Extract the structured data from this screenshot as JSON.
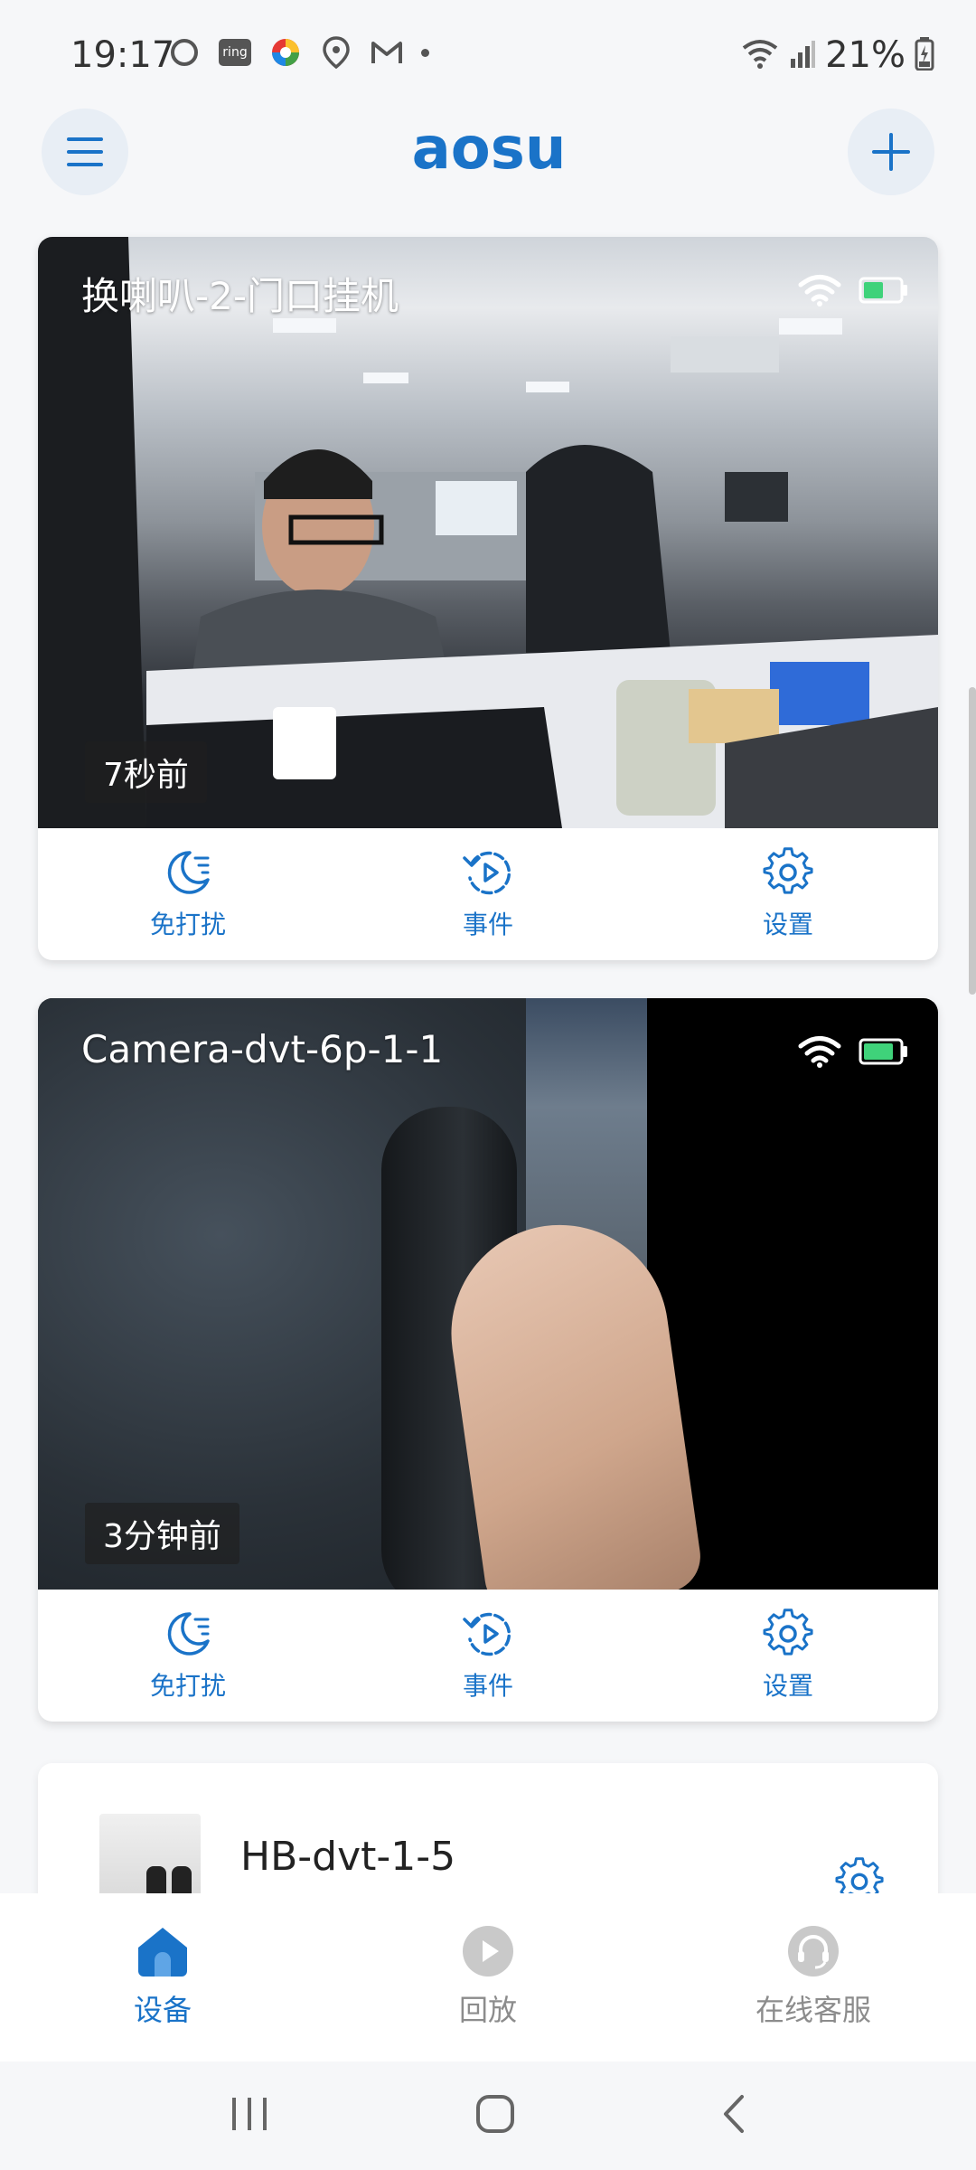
{
  "status_bar": {
    "time": "19:17",
    "ring_label": "ring",
    "battery_percent": "21%"
  },
  "header": {
    "logo_text": "aosu",
    "brand_color": "#1a73c8"
  },
  "cameras": [
    {
      "name": "换喇叭-2-门口挂机",
      "last_seen": "7秒前",
      "battery_level": 0.55,
      "actions": [
        "免打扰",
        "事件",
        "设置"
      ]
    },
    {
      "name": "Camera-dvt-6p-1-1",
      "last_seen": "3分钟前",
      "battery_level": 0.85,
      "actions": [
        "免打扰",
        "事件",
        "设置"
      ]
    }
  ],
  "hub": {
    "name": "HB-dvt-1-5"
  },
  "bottom_nav": {
    "items": [
      {
        "label": "设备",
        "icon": "home-icon",
        "active": true
      },
      {
        "label": "回放",
        "icon": "play-icon",
        "active": false
      },
      {
        "label": "在线客服",
        "icon": "headset-icon",
        "active": false
      }
    ]
  }
}
